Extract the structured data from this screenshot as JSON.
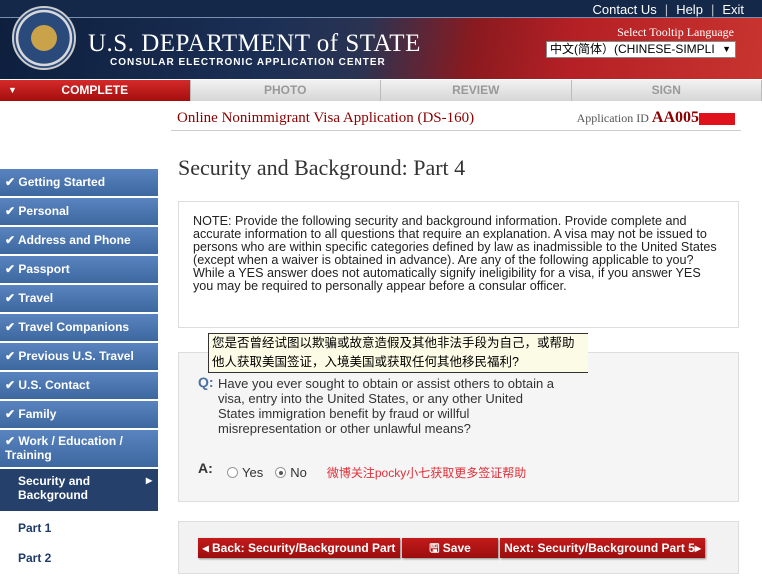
{
  "header": {
    "title": "U.S. DEPARTMENT of STATE",
    "subtitle": "CONSULAR ELECTRONIC APPLICATION CENTER",
    "links": [
      "Contact Us",
      "Help",
      "Exit"
    ],
    "tooltip_language_label": "Select Tooltip Language",
    "tooltip_language_value": "中文(简体）(CHINESE-SIMPLI"
  },
  "steps": [
    "COMPLETE",
    "PHOTO",
    "REVIEW",
    "SIGN"
  ],
  "app": {
    "name": "Online Nonimmigrant Visa Application (DS-160)",
    "id_label": "Application ID",
    "id_value": "AA005"
  },
  "sidebar": {
    "items": [
      "✔ Getting Started",
      "✔ Personal",
      "✔ Address and Phone",
      "✔ Passport",
      "✔ Travel",
      "✔ Travel Companions",
      "✔ Previous U.S. Travel",
      "✔ U.S. Contact",
      "✔ Family",
      "✔ Work / Education / Training"
    ],
    "current": "Security and Background",
    "subitems": [
      "Part 1",
      "Part 2"
    ]
  },
  "page": {
    "title": "Security and Background: Part 4",
    "note": "NOTE: Provide the following security and background information. Provide complete and accurate information to all questions that require an explanation. A visa may not be issued to persons who are within specific categories defined by law as inadmissible to the United States (except when a waiver is obtained in advance). Are any of the following applicable to you? While a YES answer does not automatically signify ineligibility for a visa, if you answer YES you may be required to personally appear before a consular officer.",
    "tooltip": "您是否曾经试图以欺骗或故意造假及其他非法手段为自己，或帮助他人获取美国签证，入境美国或获取任何其他移民福利?",
    "q_label": "Q:",
    "question": "Have you ever sought to obtain or assist others to obtain a visa, entry into the United States, or any other United States immigration benefit by fraud or willful misrepresentation or other unlawful means?",
    "a_label": "A:",
    "yes": "Yes",
    "no": "No",
    "selected": "No",
    "promo": "微博关注pocky小七获取更多签证帮助"
  },
  "buttons": {
    "back": "◂ Back: Security/Background Part",
    "save": "Save",
    "next": "Next: Security/Background Part 5▸"
  },
  "colors": {
    "accent": "#a40d0d",
    "nav": "#4a74b0"
  }
}
